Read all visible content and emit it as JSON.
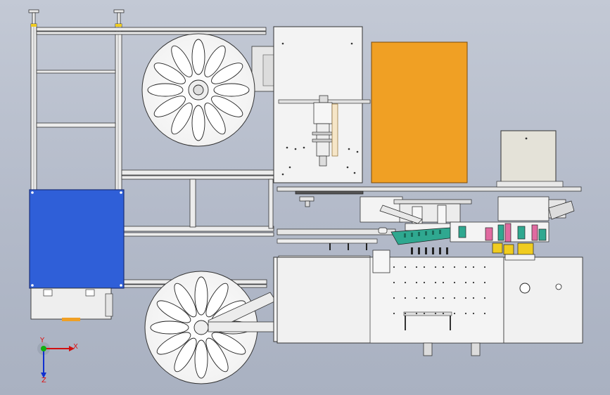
{
  "window": {
    "type": "cad-3d-viewport"
  },
  "triad": {
    "x_label": "X",
    "y_label": "Y",
    "z_label": "Z",
    "colors": {
      "x": "#d01010",
      "y": "#10b010",
      "z": "#1030d0"
    }
  },
  "colors": {
    "background_top": "#c3c9d5",
    "background_bottom": "#a9b1c1",
    "frame": "#e8e8e8",
    "electrical_box": "#2f5fd8",
    "control_cabinet": "#f0a024",
    "motor_box": "#e4e2d8",
    "accent_pink": "#e06aa0",
    "accent_yellow": "#f0cc20",
    "accent_teal": "#2fa890"
  }
}
